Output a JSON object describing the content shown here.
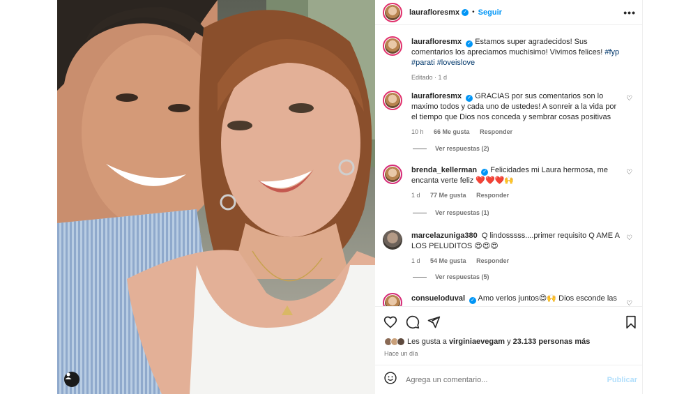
{
  "post": {
    "username": "laurafloresmx",
    "follow_label": "Seguir",
    "more_label": "•••"
  },
  "caption": {
    "username": "laurafloresmx",
    "text": "Estamos super agradecidos! Sus comentarios los apreciamos muchisimo! Vivimos felices!",
    "hashtags": "#fyp #parati #loveislove",
    "meta": "Editado · 1 d"
  },
  "comments": [
    {
      "username": "laurafloresmx",
      "text": "GRACIAS por sus comentarios son lo maximo todos y cada uno de ustedes! A sonreir a la vida por el tiempo que Dios nos conceda y sembrar cosas positivas",
      "time": "10 h",
      "likes": "66 Me gusta",
      "reply": "Responder",
      "view_replies": "Ver respuestas (2)"
    },
    {
      "username": "brenda_kellerman",
      "text": "Felicidades mi Laura hermosa, me encanta verte feliz ❤️❤️❤️🙌",
      "time": "1 d",
      "likes": "77 Me gusta",
      "reply": "Responder",
      "view_replies": "Ver respuestas (1)"
    },
    {
      "username": "marcelazuniga380",
      "text": "Q lindosssss....primer requisito Q AME A LOS PELUDITOS 😍😍😍",
      "time": "1 d",
      "likes": "54 Me gusta",
      "reply": "Responder",
      "view_replies": "Ver respuestas (5)"
    },
    {
      "username": "consueloduval",
      "text": "Amo verlos juntos😍🙌 Dios esconde las"
    }
  ],
  "likes_line": {
    "prefix": "Les gusta a",
    "user": "virginiaevegam",
    "connector": "y",
    "count": "23.133 personas más"
  },
  "timestamp": "Hace un día",
  "composer": {
    "placeholder": "Agrega un comentario...",
    "publish_label": "Publicar"
  },
  "colors": {
    "accent": "#0095f6",
    "story_ring": "#e1306c",
    "publish_disabled": "#b2dffc"
  },
  "icons": [
    "heart-icon",
    "comment-icon",
    "share-icon",
    "bookmark-icon",
    "emoji-icon",
    "verified-icon",
    "person-tag-icon"
  ]
}
